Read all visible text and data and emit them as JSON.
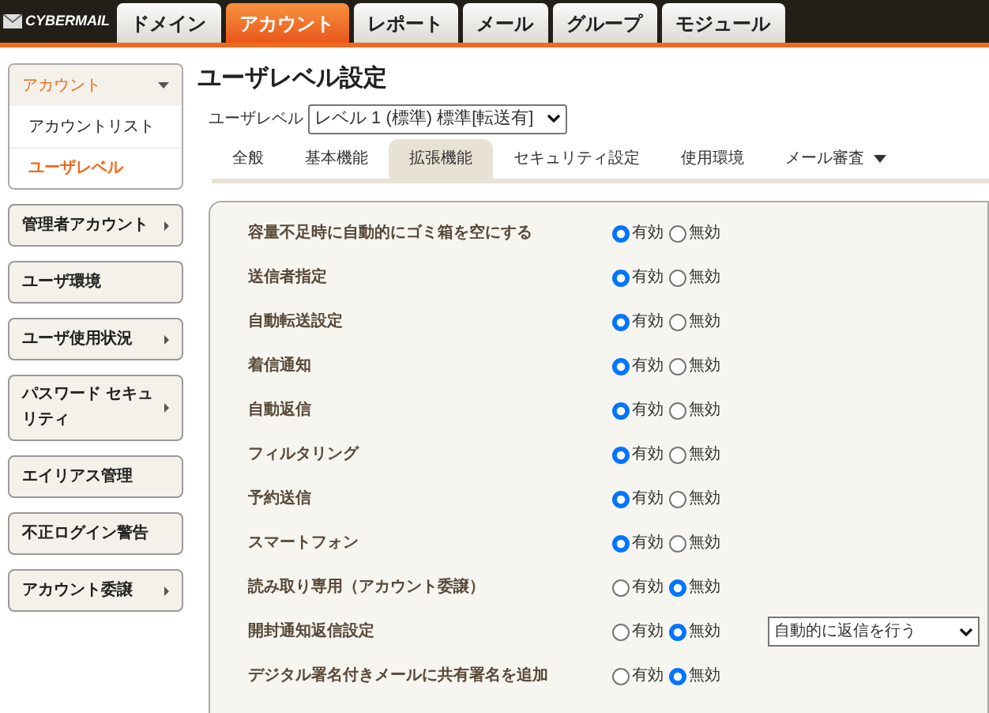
{
  "logo": {
    "text": "CYBERMAIL"
  },
  "nav_tabs": [
    {
      "label": "ドメイン",
      "selected": false
    },
    {
      "label": "アカウント",
      "selected": true
    },
    {
      "label": "レポート",
      "selected": false
    },
    {
      "label": "メール",
      "selected": false
    },
    {
      "label": "グループ",
      "selected": false
    },
    {
      "label": "モジュール",
      "selected": false
    }
  ],
  "sidebar": {
    "group": {
      "label": "アカウント",
      "expanded": true,
      "items": [
        {
          "label": "アカウントリスト",
          "selected": false
        },
        {
          "label": "ユーザレベル",
          "selected": true
        }
      ]
    },
    "items": [
      {
        "label": "管理者アカウント",
        "has_submenu": true
      },
      {
        "label": "ユーザ環境",
        "has_submenu": false
      },
      {
        "label": "ユーザ使用状況",
        "has_submenu": true
      },
      {
        "label": "パスワード セキュリティ",
        "has_submenu": true
      },
      {
        "label": "エイリアス管理",
        "has_submenu": false
      },
      {
        "label": "不正ログイン警告",
        "has_submenu": false
      },
      {
        "label": "アカウント委譲",
        "has_submenu": true
      }
    ]
  },
  "title": "ユーザレベル設定",
  "user_level": {
    "label": "ユーザレベル",
    "value": "レベル 1 (標準) 標準[転送有]"
  },
  "tabs": [
    {
      "label": "全般",
      "selected": false,
      "has_menu": false
    },
    {
      "label": "基本機能",
      "selected": false,
      "has_menu": false
    },
    {
      "label": "拡張機能",
      "selected": true,
      "has_menu": false
    },
    {
      "label": "セキュリティ設定",
      "selected": false,
      "has_menu": false
    },
    {
      "label": "使用環境",
      "selected": false,
      "has_menu": false
    },
    {
      "label": "メール審査",
      "selected": false,
      "has_menu": true
    }
  ],
  "settings": [
    {
      "label": "容量不足時に自動的にゴミ箱を空にする",
      "options": [
        {
          "label": "有効",
          "selected": true
        },
        {
          "label": "無効",
          "selected": false
        }
      ]
    },
    {
      "label": "送信者指定",
      "options": [
        {
          "label": "有効",
          "selected": true
        },
        {
          "label": "無効",
          "selected": false
        }
      ]
    },
    {
      "label": "自動転送設定",
      "options": [
        {
          "label": "有効",
          "selected": true
        },
        {
          "label": "無効",
          "selected": false
        }
      ]
    },
    {
      "label": "着信通知",
      "options": [
        {
          "label": "有効",
          "selected": true
        },
        {
          "label": "無効",
          "selected": false
        }
      ]
    },
    {
      "label": "自動返信",
      "options": [
        {
          "label": "有効",
          "selected": true
        },
        {
          "label": "無効",
          "selected": false
        }
      ]
    },
    {
      "label": "フィルタリング",
      "options": [
        {
          "label": "有効",
          "selected": true
        },
        {
          "label": "無効",
          "selected": false
        }
      ]
    },
    {
      "label": "予約送信",
      "options": [
        {
          "label": "有効",
          "selected": true
        },
        {
          "label": "無効",
          "selected": false
        }
      ]
    },
    {
      "label": "スマートフォン",
      "options": [
        {
          "label": "有効",
          "selected": true
        },
        {
          "label": "無効",
          "selected": false
        }
      ]
    },
    {
      "label": "読み取り専用（アカウント委譲）",
      "options": [
        {
          "label": "有効",
          "selected": false
        },
        {
          "label": "無効",
          "selected": true
        }
      ]
    },
    {
      "label": "開封通知返信設定",
      "options": [
        {
          "label": "有効",
          "selected": false
        },
        {
          "label": "無効",
          "selected": true
        }
      ],
      "select": "自動的に返信を行う"
    },
    {
      "label": "デジタル署名付きメールに共有署名を追加",
      "options": [
        {
          "label": "有効",
          "selected": false
        },
        {
          "label": "無効",
          "selected": true
        }
      ]
    }
  ]
}
